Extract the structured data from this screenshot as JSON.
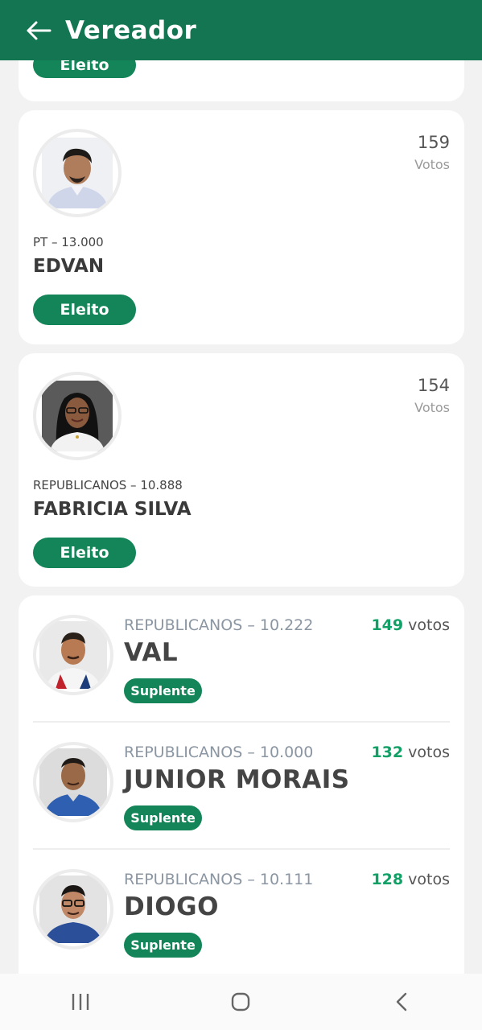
{
  "header": {
    "title": "Vereador",
    "back_icon": "arrow-left-icon"
  },
  "colors": {
    "app_bar": "#137552",
    "badge": "#138559",
    "votes_highlight": "#12a067",
    "background": "#f2f2f2"
  },
  "partial_card": {
    "status": "Eleito"
  },
  "elected": [
    {
      "party_number": "PT – 13.000",
      "name": "EDVAN",
      "votes": "159",
      "votes_label": "Votos",
      "status": "Eleito"
    },
    {
      "party_number": "REPUBLICANOS – 10.888",
      "name": "FABRICIA SILVA",
      "votes": "154",
      "votes_label": "Votos",
      "status": "Eleito"
    }
  ],
  "suplentes": [
    {
      "party_number": "REPUBLICANOS – 10.222",
      "name": "VAL",
      "votes": "149",
      "votes_suffix": "votos",
      "status": "Suplente"
    },
    {
      "party_number": "REPUBLICANOS – 10.000",
      "name": "JUNIOR MORAIS",
      "votes": "132",
      "votes_suffix": "votos",
      "status": "Suplente"
    },
    {
      "party_number": "REPUBLICANOS – 10.111",
      "name": "DIOGO",
      "votes": "128",
      "votes_suffix": "votos",
      "status": "Suplente"
    }
  ],
  "system_nav": {
    "recents_icon": "recents-icon",
    "home_icon": "home-icon",
    "back_icon": "back-chevron-icon"
  }
}
